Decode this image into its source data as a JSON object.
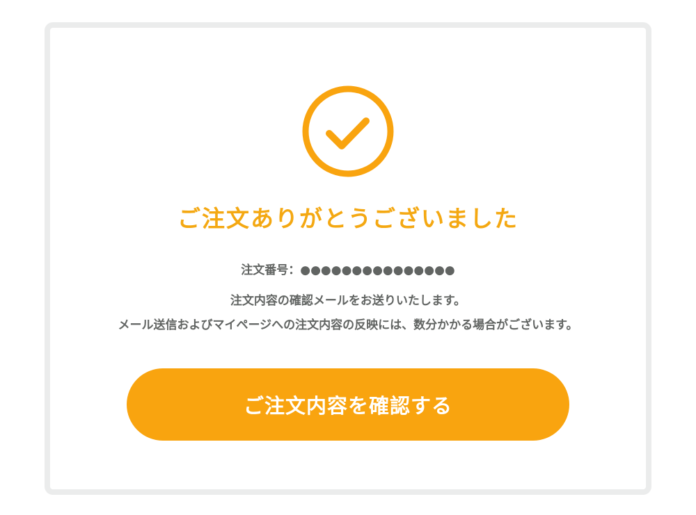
{
  "colors": {
    "accent": "#f9a40f",
    "title": "#f4a812",
    "text": "#616462",
    "border": "#ebecec"
  },
  "icon": "check-circle-icon",
  "title": "ご注文ありがとうございました",
  "order": {
    "label": "注文番号：",
    "value": "●●●●●●●●●●●●●●●"
  },
  "message": {
    "line1": "注文内容の確認メールをお送りいたします。",
    "line2": "メール送信およびマイページへの注文内容の反映には、数分かかる場合がございます。"
  },
  "button": {
    "label": "ご注文内容を確認する"
  }
}
